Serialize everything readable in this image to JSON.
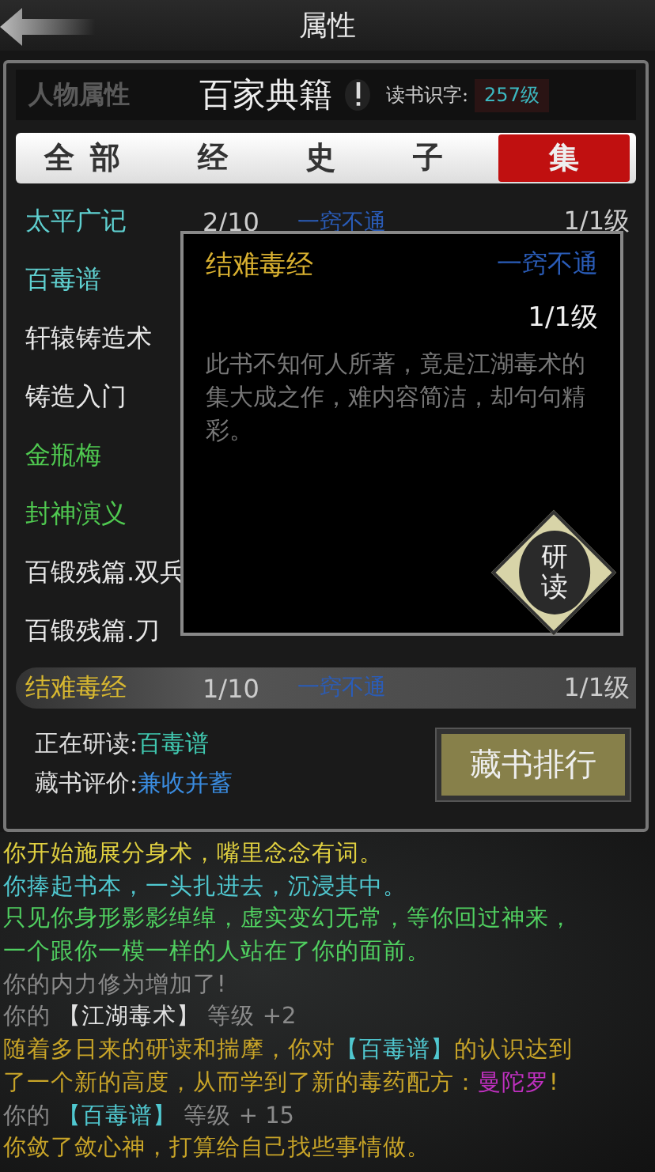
{
  "header": {
    "title": "属性"
  },
  "panel_tabs": [
    {
      "label": "人物属性",
      "selected": false
    },
    {
      "label": "百家典籍",
      "selected": true
    }
  ],
  "reading_skill": {
    "label": "读书识字:",
    "value": "257级"
  },
  "categories": [
    {
      "label": "全部",
      "selected": false
    },
    {
      "label": "经",
      "selected": false
    },
    {
      "label": "史",
      "selected": false
    },
    {
      "label": "子",
      "selected": false
    },
    {
      "label": "集",
      "selected": true
    }
  ],
  "books": [
    {
      "name": "太平广记",
      "color": "#5fd0d0",
      "selected": false,
      "progress": "2/10",
      "mastery": "一窍不通",
      "level": "1/1级"
    },
    {
      "name": "百毒谱",
      "color": "#5fd0d0",
      "selected": false
    },
    {
      "name": "轩辕铸造术",
      "color": "#e8e8e8",
      "selected": false
    },
    {
      "name": "铸造入门",
      "color": "#e8e8e8",
      "selected": false
    },
    {
      "name": "金瓶梅",
      "color": "#4fc850",
      "selected": false
    },
    {
      "name": "封神演义",
      "color": "#4fc850",
      "selected": false
    },
    {
      "name": "百锻残篇.双兵",
      "color": "#e8e8e8",
      "selected": false
    },
    {
      "name": "百锻残篇.刀",
      "color": "#e8e8e8",
      "selected": false
    },
    {
      "name": "结难毒经",
      "color": "#d8b830",
      "selected": true,
      "progress": "1/10",
      "mastery": "一窍不通",
      "level": "1/1级"
    }
  ],
  "popup": {
    "title": "结难毒经",
    "mastery": "一窍不通",
    "level": "1/1级",
    "description": "此书不知何人所著，竟是江湖毒术的集大成之作，难内容简洁，却句句精彩。",
    "action": "研读"
  },
  "status": [
    {
      "label": "正在研读:",
      "value": "百毒谱",
      "color": "#40c8b0"
    },
    {
      "label": "藏书评价:",
      "value": "兼收并蓄",
      "color": "#3a8ce0"
    }
  ],
  "ranking_button": "藏书排行",
  "log": [
    [
      {
        "text": "你开始施展分身术，嘴里念念有词。",
        "color": "#e0d040"
      }
    ],
    [
      {
        "text": "你捧起书本，一头扎进去，沉浸其中。",
        "color": "#50c8d0"
      }
    ],
    [
      {
        "text": "只见你身形影影绰绰，虚实变幻无常，等你回过神来，",
        "color": "#50d060"
      }
    ],
    [
      {
        "text": "一个跟你一模一样的人站在了你的面前。",
        "color": "#50d060"
      }
    ],
    [
      {
        "text": "你的内力修为增加了!",
        "color": "#8a8a8a"
      }
    ],
    [
      {
        "text": "你的 ",
        "color": "#8a8a8a"
      },
      {
        "text": "【江湖毒术】",
        "color": "#e0e0e0"
      },
      {
        "text": " 等级 +2",
        "color": "#8a8a8a"
      }
    ],
    [
      {
        "text": "随着多日来的研读和揣摩，你对",
        "color": "#c8a428"
      },
      {
        "text": "【百毒谱】",
        "color": "#50c8d0"
      },
      {
        "text": "的认识达到",
        "color": "#c8a428"
      }
    ],
    [
      {
        "text": "了一个新的高度，从而学到了新的毒药配方：",
        "color": "#c8a428"
      },
      {
        "text": "曼陀罗",
        "color": "#c030c0"
      },
      {
        "text": "!",
        "color": "#c8a428"
      }
    ],
    [
      {
        "text": "你的 ",
        "color": "#8a8a8a"
      },
      {
        "text": "【百毒谱】",
        "color": "#50c8d0"
      },
      {
        "text": " 等级 + 15",
        "color": "#8a8a8a"
      }
    ],
    [
      {
        "text": "你敛了敛心神，打算给自己找些事情做。",
        "color": "#c8a428"
      }
    ]
  ]
}
